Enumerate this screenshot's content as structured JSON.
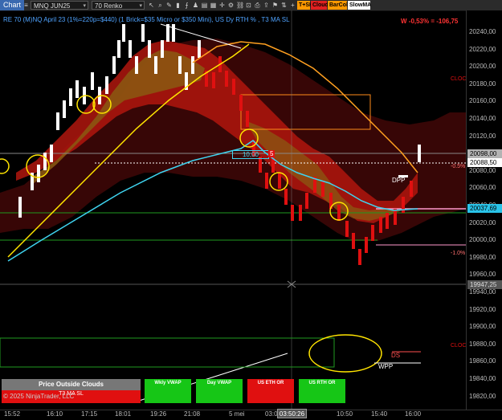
{
  "toolbar": {
    "chart_label": "Chart",
    "instrument": "MNQ JUN25",
    "bar_type": "70 Renko",
    "toggles": [
      {
        "label": "T+SK",
        "color": "#ff9900"
      },
      {
        "label": "Cloud",
        "color": "#e02020"
      },
      {
        "label": "BarCol",
        "color": "#ff9900"
      },
      {
        "label": "SlowMA",
        "color": "#ffffff"
      }
    ]
  },
  "chart": {
    "info_line": "RE 70 (M)NQ April 23 (1%=220p=$440) (1 Brick=$35 Micro or $350 Mini), US Dy RTH % , T3 MA SL",
    "pnl": "W -0,53% = -106,75",
    "labels": {
      "cloc_top": "CLOC",
      "cloc_bottom": "CLOC",
      "pct_pos": "-0.5%",
      "pct_neg": "-1.0%",
      "dpp": "DPP",
      "ds": "DS",
      "wpp": "WPP",
      "box_value": "10,00",
      "box_count": "5"
    },
    "copyright": "© 2025 NinjaTrader, LLC"
  },
  "price_axis": {
    "ticks": [
      "20240,00",
      "20220,00",
      "20200,00",
      "20180,00",
      "20160,00",
      "20140,00",
      "20120,00",
      "20100,00",
      "20080,00",
      "20060,00",
      "20040,00",
      "20020,00",
      "20000,00",
      "19980,00",
      "19960,00",
      "19940,00",
      "19920,00",
      "19900,00",
      "19880,00",
      "19860,00",
      "19840,00",
      "19820,00"
    ],
    "markers": [
      {
        "label": "20098,00",
        "bg": "#b3b3b3",
        "fg": "#000"
      },
      {
        "label": "20088,50",
        "bg": "#ffffff",
        "fg": "#000"
      },
      {
        "label": "20037,69",
        "bg": "#29c3e8",
        "fg": "#000"
      },
      {
        "label": "19947,25",
        "bg": "#555555",
        "fg": "#ddd"
      }
    ]
  },
  "time_axis": {
    "ticks": [
      "15:52",
      "16:10",
      "17:15",
      "18:01",
      "19:26",
      "21:08",
      "5 mei",
      "03:00",
      "10:50",
      "15:40",
      "16:00"
    ],
    "cursor_time": "03:50:26"
  },
  "panel": {
    "price_outside": "Price Outside Clouds",
    "t3_label": "T3 MA SL",
    "buttons": [
      {
        "label": "Wkly VWAP",
        "color": "#16c616"
      },
      {
        "label": "Day VWAP",
        "color": "#16c616"
      },
      {
        "label": "US ETH OR",
        "color": "#e01010"
      },
      {
        "label": "US RTH OR",
        "color": "#16c616"
      }
    ]
  }
}
